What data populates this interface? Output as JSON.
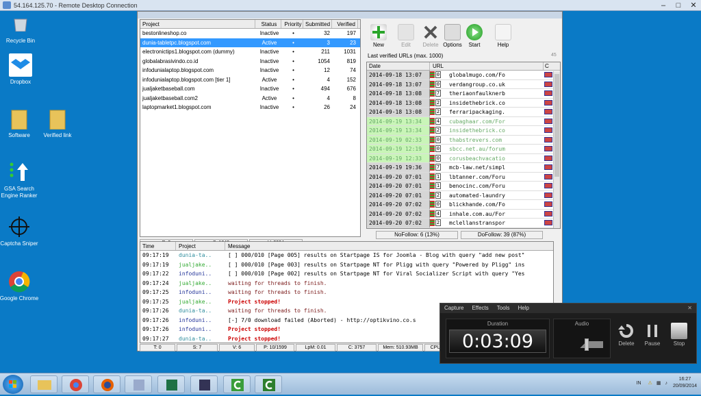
{
  "rdp": {
    "title": "54.164.125.70 - Remote Desktop Connection",
    "min": "–",
    "max": "□",
    "close": "✕"
  },
  "desktop": {
    "icons": [
      {
        "label": "Recycle Bin",
        "icon": "recycle-bin-icon"
      },
      {
        "label": "Dropbox",
        "icon": "dropbox-icon"
      },
      {
        "label": "Software",
        "icon": "folder-icon"
      },
      {
        "label": "Verified link",
        "icon": "folder-icon"
      },
      {
        "label": "GSA Search Engine Ranker",
        "icon": "gsa-icon"
      },
      {
        "label": "Captcha Sniper",
        "icon": "crosshair-icon"
      },
      {
        "label": "Google Chrome",
        "icon": "chrome-icon"
      }
    ]
  },
  "projects": {
    "headers": [
      "Project",
      "Status",
      "Priority",
      "Submitted",
      "Verified"
    ],
    "rows": [
      {
        "name": "bestonlineshop.co",
        "status": "Inactive",
        "priority": "•",
        "submitted": "32",
        "verified": "197"
      },
      {
        "name": "dunia-tabletpc.blogspot.com",
        "status": "Active",
        "priority": "•",
        "submitted": "3",
        "verified": "23"
      },
      {
        "name": "electronictips1.blogspot.com (dummy)",
        "status": "Inactive",
        "priority": "•",
        "submitted": "211",
        "verified": "1031"
      },
      {
        "name": "globalabrasivindo.co.id",
        "status": "Inactive",
        "priority": "•",
        "submitted": "1054",
        "verified": "819"
      },
      {
        "name": "infodunialaptop.blogspot.com",
        "status": "Inactive",
        "priority": "•",
        "submitted": "12",
        "verified": "74"
      },
      {
        "name": "infodunialaptop.blogspot.com [tier 1]",
        "status": "Active",
        "priority": "•",
        "submitted": "4",
        "verified": "152"
      },
      {
        "name": "jualjaketbaseball.com",
        "status": "Inactive",
        "priority": "•",
        "submitted": "494",
        "verified": "676"
      },
      {
        "name": "jualjaketbaseball.com2",
        "status": "Active",
        "priority": "•",
        "submitted": "4",
        "verified": "8"
      },
      {
        "name": "laptopmarket1.blogspot.com",
        "status": "Inactive",
        "priority": "•",
        "submitted": "26",
        "verified": "24"
      }
    ],
    "stats": [
      "P: 9",
      "S: 1840",
      "V: 3004"
    ]
  },
  "toolbar": {
    "new": "New",
    "edit": "Edit",
    "delete": "Delete",
    "options": "Options",
    "start": "Start",
    "help": "Help"
  },
  "verified": {
    "label": "Last verified URLs (max. 1000)",
    "count": "45",
    "headers": [
      "Date",
      "URL",
      "C"
    ],
    "rows": [
      {
        "date": "2014-09-18 13:07",
        "n": "0",
        "url": "globalmugo.com/Fo",
        "g": false
      },
      {
        "date": "2014-09-18 13:07",
        "n": "0",
        "url": "verdangroup.co.uk",
        "g": false
      },
      {
        "date": "2014-09-18 13:08",
        "n": "7",
        "url": "theriaonfaulknerb",
        "g": false
      },
      {
        "date": "2014-09-18 13:08",
        "n": "2",
        "url": "insidethebrick.co",
        "g": false
      },
      {
        "date": "2014-09-18 13:08",
        "n": "2",
        "url": "ferraripackaging.",
        "g": false
      },
      {
        "date": "2014-09-19 13:34",
        "n": "4",
        "url": "cubaghaar.com/For",
        "g": true
      },
      {
        "date": "2014-09-19 13:34",
        "n": "2",
        "url": "insidethebrick.co",
        "g": true
      },
      {
        "date": "2014-09-19 02:33",
        "n": "0",
        "url": "thabstrevers.com",
        "g": true
      },
      {
        "date": "2014-09-19 12:19",
        "n": "0",
        "url": "sbcc.net.au/forum",
        "g": true
      },
      {
        "date": "2014-09-19 12:33",
        "n": "0",
        "url": "corusbeachvacatio",
        "g": true
      },
      {
        "date": "2014-09-19 19:36",
        "n": "7",
        "url": "mcb-law.net/simpl",
        "g": false
      },
      {
        "date": "2014-09-20 07:01",
        "n": "1",
        "url": "lbtanner.com/Foru",
        "g": false
      },
      {
        "date": "2014-09-20 07:01",
        "n": "1",
        "url": "benocinc.com/Foru",
        "g": false
      },
      {
        "date": "2014-09-20 07:01",
        "n": "2",
        "url": "automated-laundry",
        "g": false
      },
      {
        "date": "2014-09-20 07:02",
        "n": "0",
        "url": "blickhande.com/Fo",
        "g": false
      },
      {
        "date": "2014-09-20 07:02",
        "n": "4",
        "url": "inhale.com.au/For",
        "g": false
      },
      {
        "date": "2014-09-20 07:02",
        "n": "2",
        "url": "mclellanstranspor",
        "g": false
      }
    ],
    "nofollow": "NoFollow: 6 (13%)",
    "dofollow": "DoFollow: 39 (87%)"
  },
  "log": {
    "headers": [
      "Time",
      "Project",
      "Message"
    ],
    "rows": [
      {
        "time": "09:17:19",
        "project": "dunia-ta..",
        "pcolor": "#2c8c9c",
        "msg": "[ ] 000/010 [Page 005] results on Startpage IS for Joomla - Blog with query \"add new post\"",
        "mcolor": "#000"
      },
      {
        "time": "09:17:19",
        "project": "jualjake..",
        "pcolor": "#33aa33",
        "msg": "[ ] 000/010 [Page 003] results on Startpage NT for Pligg with query \"Powered by Pligg\" ins",
        "mcolor": "#000"
      },
      {
        "time": "09:17:22",
        "project": "infoduni..",
        "pcolor": "#223399",
        "msg": "[ ] 000/010 [Page 002] results on Startpage NT for Viral Socializer Script with query \"Yes",
        "mcolor": "#000"
      },
      {
        "time": "09:17:24",
        "project": "jualjake..",
        "pcolor": "#33aa33",
        "msg": "waiting for threads to finish.",
        "mcolor": "#7a1a1a"
      },
      {
        "time": "09:17:25",
        "project": "infoduni..",
        "pcolor": "#223399",
        "msg": "waiting for threads to finish.",
        "mcolor": "#7a1a1a"
      },
      {
        "time": "09:17:25",
        "project": "jualjake..",
        "pcolor": "#33aa33",
        "msg": "Project stopped!",
        "mcolor": "#cc0000"
      },
      {
        "time": "09:17:26",
        "project": "dunia-ta..",
        "pcolor": "#2c8c9c",
        "msg": "waiting for threads to finish.",
        "mcolor": "#7a1a1a"
      },
      {
        "time": "09:17:26",
        "project": "infoduni..",
        "pcolor": "#223399",
        "msg": "[-] 7/0 download failed (Aborted) - http://optikvino.co.s",
        "mcolor": "#000"
      },
      {
        "time": "09:17:26",
        "project": "infoduni..",
        "pcolor": "#223399",
        "msg": "Project stopped!",
        "mcolor": "#cc0000"
      },
      {
        "time": "09:17:27",
        "project": "dunia-ta..",
        "pcolor": "#2c8c9c",
        "msg": "Project stopped!",
        "mcolor": "#cc0000"
      }
    ]
  },
  "status": [
    "T: 0",
    "S: 7",
    "V: 6",
    "P: 10/1599",
    "LpM: 0.01",
    "C: 3757",
    "Mem: 510.93MB",
    "CPU: 0%"
  ],
  "recorder": {
    "menu": [
      "Capture",
      "Effects",
      "Tools",
      "Help"
    ],
    "close": "✕",
    "duration_label": "Duration",
    "duration": "0:03:09",
    "audio_label": "Audio",
    "audio_level": 0.6,
    "buttons": {
      "delete": "Delete",
      "pause": "Pause",
      "stop": "Stop"
    }
  },
  "tray": {
    "lang": "IN",
    "time": "16:27",
    "date": "20/09/2014"
  }
}
